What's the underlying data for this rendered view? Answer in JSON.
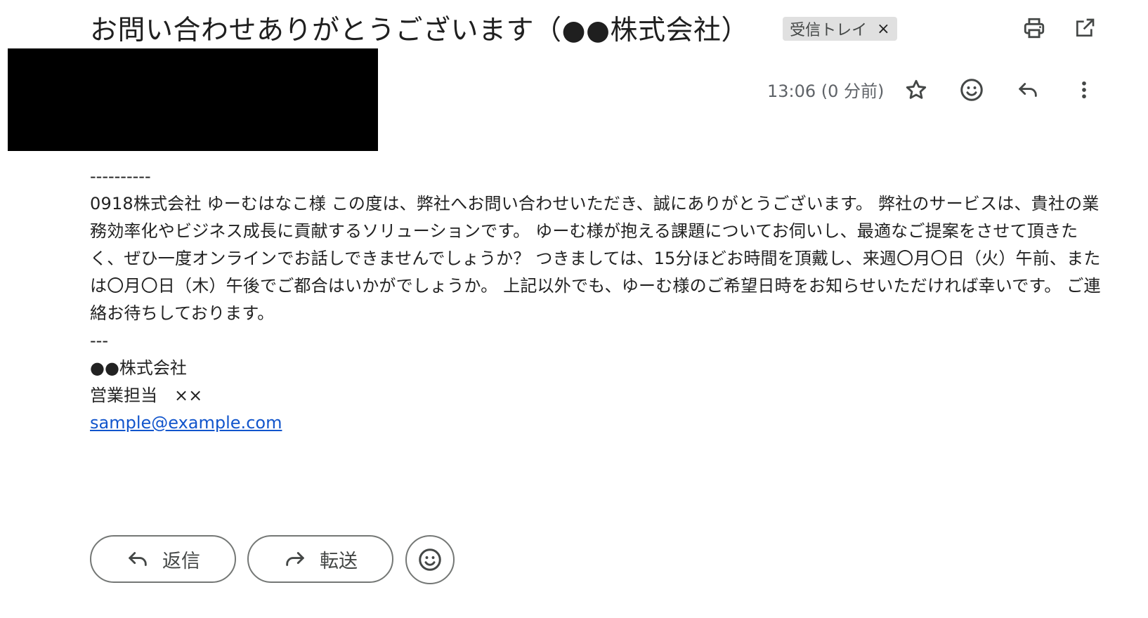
{
  "header": {
    "subject": "お問い合わせありがとうございます（●●株式会社）",
    "label_chip": "受信トレイ",
    "label_chip_remove": "×"
  },
  "message": {
    "timestamp": "13:06 (0 分前)",
    "body": {
      "separator_top": "----------",
      "paragraph": "0918株式会社 ゆーむはなこ様 この度は、弊社へお問い合わせいただき、誠にありがとうございます。 弊社のサービスは、貴社の業務効率化やビジネス成長に貢献するソリューションです。 ゆーむ様が抱える課題についてお伺いし、最適なご提案をさせて頂きたく、ぜひ一度オンラインでお話しできませんでしょうか？ つきましては、15分ほどお時間を頂戴し、来週〇月〇日（火）午前、または〇月〇日（木）午後でご都合はいかがでしょうか。 上記以外でも、ゆーむ様のご希望日時をお知らせいただければ幸いです。 ご連絡お待ちしております。",
      "separator_bottom": "---",
      "signature_company": "●●株式会社",
      "signature_name": "営業担当　××",
      "signature_email": "sample@example.com"
    }
  },
  "actions": {
    "reply_label": "返信",
    "forward_label": "転送"
  },
  "icons": {
    "print": "print-icon",
    "open_new_window": "open-in-new-window-icon",
    "star": "star-icon",
    "emoji": "emoji-icon",
    "reply": "reply-icon",
    "more": "more-vert-icon",
    "forward": "forward-icon"
  },
  "colors": {
    "chip_background": "#e0e0e0",
    "link": "#1155cc",
    "icon": "#444746",
    "border": "#747775"
  }
}
